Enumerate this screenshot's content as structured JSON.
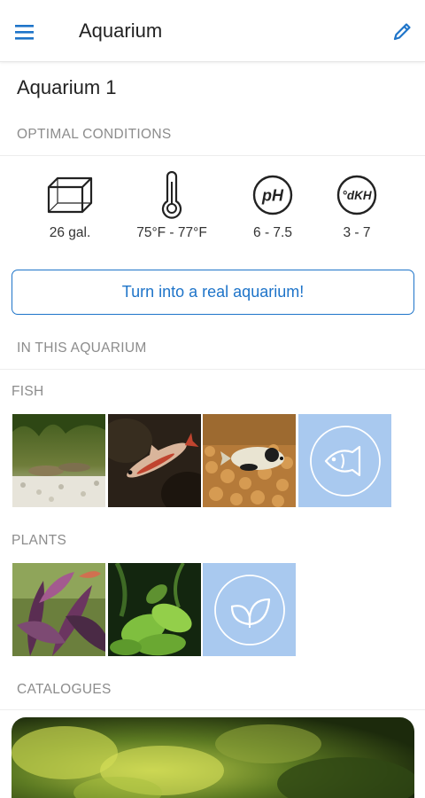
{
  "appbar": {
    "title": "Aquarium",
    "menu_icon": "hamburger-menu-icon",
    "edit_icon": "pencil-icon",
    "accent": "#1e74c9"
  },
  "aquarium": {
    "name": "Aquarium 1"
  },
  "optimal_conditions": {
    "heading": "OPTIMAL CONDITIONS",
    "items": [
      {
        "icon": "tank-icon",
        "value": "26 gal."
      },
      {
        "icon": "thermometer-icon",
        "value": "75°F - 77°F"
      },
      {
        "icon": "ph-icon",
        "icon_text": "pH",
        "value": "6 - 7.5"
      },
      {
        "icon": "dkh-icon",
        "icon_text": "°dKH",
        "value": "3 - 7"
      }
    ]
  },
  "cta": {
    "label": "Turn into a real aquarium!"
  },
  "in_this_aquarium": {
    "heading": "IN THIS AQUARIUM",
    "fish": {
      "label": "FISH",
      "photos": [
        "fish-photo-corydoras",
        "fish-photo-rasbora",
        "fish-photo-tetra"
      ],
      "add_icon": "fish-outline-icon"
    },
    "plants": {
      "label": "PLANTS",
      "photos": [
        "plant-photo-purple-leaves",
        "plant-photo-green-leaves"
      ],
      "add_icon": "leaf-outline-icon"
    }
  },
  "catalogues": {
    "heading": "CATALOGUES"
  },
  "colors": {
    "add_tile": "#a9c9ef",
    "section_text": "#8c8c8c"
  }
}
